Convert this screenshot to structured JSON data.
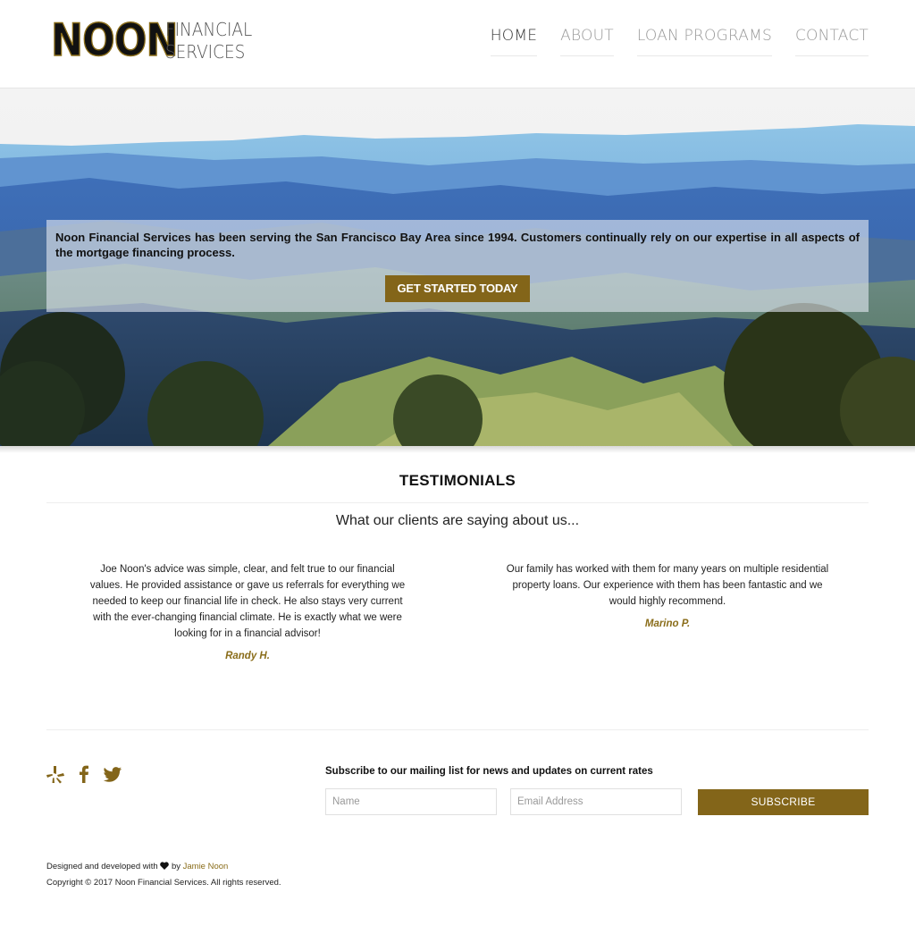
{
  "brand": {
    "name": "NOON",
    "sub_line1": "FINANCIAL",
    "sub_line2": "SERVICES"
  },
  "nav": [
    {
      "label": "HOME",
      "active": true
    },
    {
      "label": "ABOUT",
      "active": false
    },
    {
      "label": "LOAN PROGRAMS",
      "active": false
    },
    {
      "label": "CONTACT",
      "active": false
    }
  ],
  "hero": {
    "text": "Noon Financial Services has been serving the San Francisco Bay Area since 1994. Customers continually rely on our expertise in all aspects of the mortgage financing process.",
    "cta_label": "GET STARTED TODAY"
  },
  "testimonials": {
    "title": "TESTIMONIALS",
    "subtitle": "What our clients are saying about us...",
    "items": [
      {
        "quote": "Joe Noon's advice was simple, clear, and felt true to our financial values. He provided assistance or gave us referrals for everything we needed to keep our financial life in check. He also stays very current with the ever-changing financial climate. He is exactly what we were looking for in a financial advisor!",
        "author": "Randy H."
      },
      {
        "quote": "Our family has worked with them for many years on multiple residential property loans. Our experience with them has been fantastic and we would highly recommend.",
        "author": "Marino P."
      }
    ]
  },
  "newsletter": {
    "label": "Subscribe to our mailing list for news and updates on current rates",
    "name_placeholder": "Name",
    "email_placeholder": "Email Address",
    "button_label": "SUBSCRIBE"
  },
  "social": [
    "yelp-icon",
    "facebook-icon",
    "twitter-icon"
  ],
  "footer": {
    "designed_prefix": "Designed and developed with",
    "designed_by": "by",
    "author_link": "Jamie Noon",
    "copyright": "Copyright © 2017 Noon Financial Services. All rights reserved."
  },
  "colors": {
    "accent": "#836519",
    "author": "#8a6d1a"
  }
}
